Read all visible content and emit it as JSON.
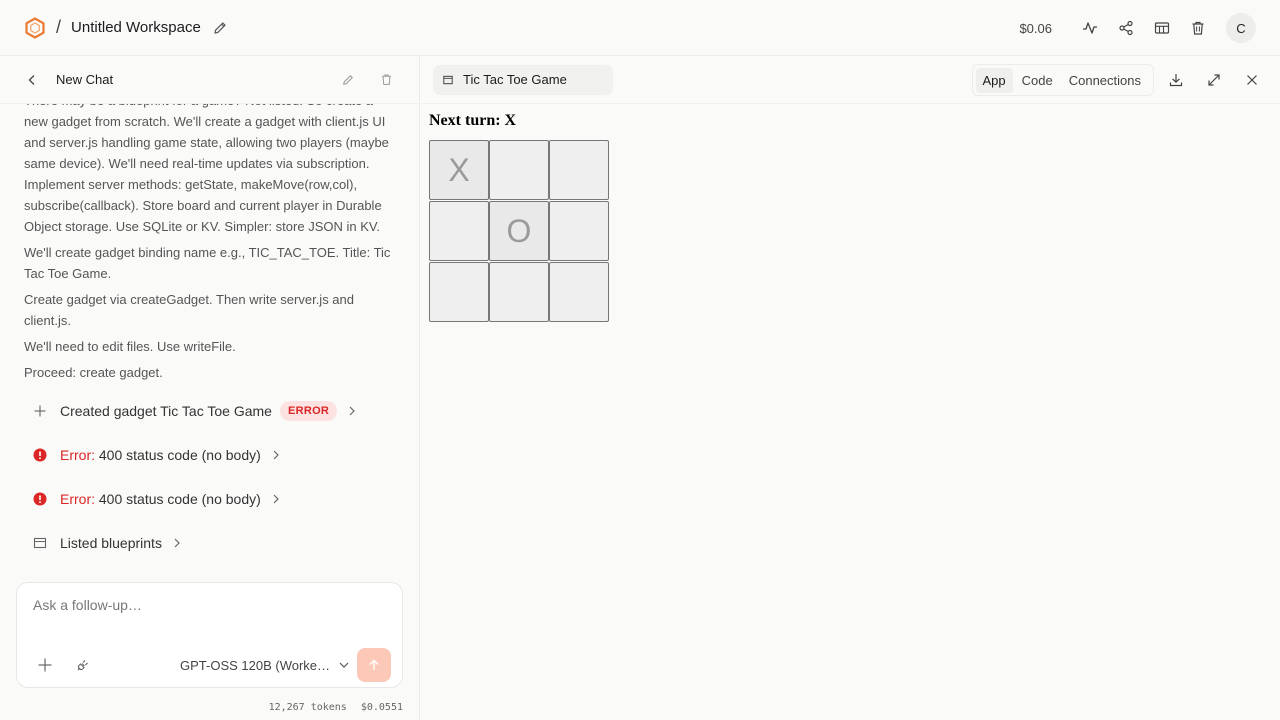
{
  "workspace": {
    "title": "Untitled Workspace",
    "cost": "$0.06",
    "avatar_initial": "C",
    "brand_color": "#ea7a2f"
  },
  "chat": {
    "title": "New Chat",
    "paragraphs": [
      "There may be a blueprint for a game? Not listed. So create a new gadget from scratch. We'll create a gadget with client.js UI and server.js handling game state, allowing two players (maybe same device). We'll need real-time updates via subscription. Implement server methods: getState, makeMove(row,col), subscribe(callback). Store board and current player in Durable Object storage. Use SQLite or KV. Simpler: store JSON in KV.",
      "We'll create gadget binding name e.g., TIC_TAC_TOE. Title: Tic Tac Toe Game.",
      "Create gadget via createGadget. Then write server.js and client.js.",
      "We'll need to edit files. Use writeFile.",
      "Proceed: create gadget."
    ],
    "tool_created": {
      "text": "Created gadget Tic Tac Toe Game",
      "badge": "ERROR"
    },
    "errors": [
      {
        "label": "Error:",
        "message": "400 status code (no body)"
      },
      {
        "label": "Error:",
        "message": "400 status code (no body)"
      }
    ],
    "partial_item": "Listed blueprints"
  },
  "composer": {
    "placeholder": "Ask a follow-up…",
    "model": "GPT-OSS 120B (Worke…",
    "tokens": "12,267 tokens",
    "cost": "$0.0551"
  },
  "preview": {
    "tab_label": "Tic Tac Toe Game",
    "modes": [
      "App",
      "Code",
      "Connections"
    ],
    "active_mode": "App"
  },
  "game": {
    "turn_label": "Next turn: X",
    "board": [
      [
        "X",
        "",
        ""
      ],
      [
        "",
        "O",
        ""
      ],
      [
        "",
        "",
        ""
      ]
    ]
  }
}
